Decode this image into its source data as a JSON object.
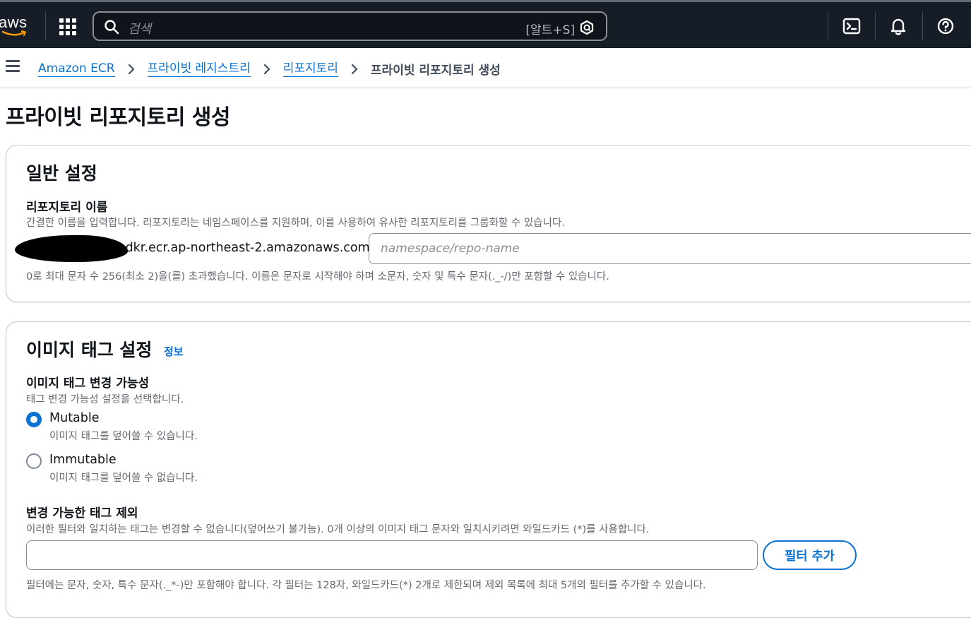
{
  "header": {
    "search_placeholder": "검색",
    "search_shortcut": "[알트+S]",
    "colors": {
      "background": "#161d26",
      "text": "#ffffff"
    },
    "icons": [
      "aws-logo",
      "apps-grid-icon",
      "search-icon",
      "amazon-q-icon",
      "cloudshell-icon",
      "bell-icon",
      "help-icon"
    ]
  },
  "breadcrumb": {
    "items": [
      "Amazon ECR",
      "프라이빗 레지스트리",
      "리포지토리"
    ],
    "current": "프라이빗 리포지토리 생성"
  },
  "page": {
    "title": "프라이빗 리포지토리 생성"
  },
  "general": {
    "title": "일반 설정",
    "repo_name_label": "리포지토리 이름",
    "repo_name_desc": "간결한 이름을 입력합니다. 리포지토리는 네임스페이스를 지원하며, 이를 사용하여 유사한 리포지토리를 그룹화할 수 있습니다.",
    "uri_prefix": ".dkr.ecr.ap-northeast-2.amazonaws.com/",
    "repo_name_placeholder": "namespace/repo-name",
    "repo_name_constraint": "0로 최대 문자 수 256(최소 2)을(를) 초과했습니다. 이름은 문자로 시작해야 하며 소문자, 숫자 및 특수 문자(._-/)만 포함할 수 있습니다."
  },
  "tags": {
    "title": "이미지 태그 설정",
    "info": "정보",
    "mutability_label": "이미지 태그 변경 가능성",
    "mutability_desc": "태그 변경 가능성 설정을 선택합니다.",
    "options": [
      {
        "label": "Mutable",
        "desc": "이미지 태그를 덮어쓸 수 있습니다.",
        "selected": true
      },
      {
        "label": "Immutable",
        "desc": "이미지 태그를 덮어쓸 수 없습니다.",
        "selected": false
      }
    ],
    "exclusion_label": "변경 가능한 태그 제외",
    "exclusion_desc": "이러한 필터와 일치하는 태그는 변경할 수 없습니다(덮어쓰기 불가능). 0개 이상의 이미지 태그 문자와 일치시키려면 와일드카드 (*)를 사용합니다.",
    "add_filter_button": "필터 추가",
    "filter_constraint": "필터에는 문자, 숫자, 특수 문자(._*-)만 포함해야 합니다. 각 필터는 128자, 와일드카드(*) 2개로 제한되며 제외 목록에 최대 5개의 필터를 추가할 수 있습니다.",
    "accent_color": "#0972d3"
  }
}
